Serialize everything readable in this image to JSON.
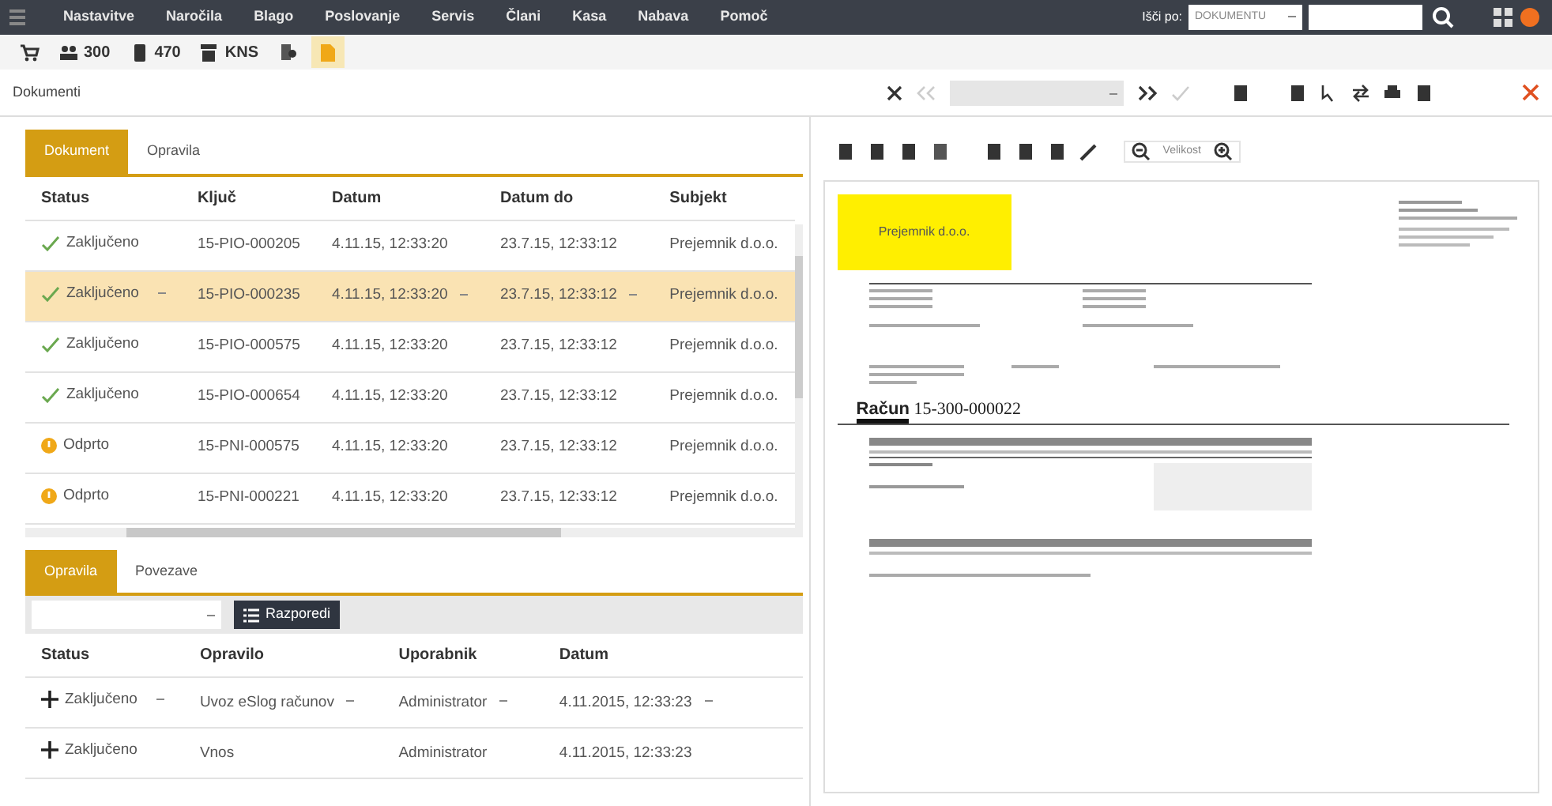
{
  "menu": [
    "Nastavitve",
    "Naročila",
    "Blago",
    "Poslovanje",
    "Servis",
    "Člani",
    "Kasa",
    "Nabava",
    "Pomoč"
  ],
  "search": {
    "label": "Išči po:",
    "option": "DOKUMENTU"
  },
  "toolbar": [
    {
      "kind": "cart",
      "selected": false
    },
    {
      "kind": "people",
      "label": "300",
      "selected": false
    },
    {
      "kind": "phone",
      "label": "470",
      "selected": false
    },
    {
      "kind": "register",
      "label": "KNS",
      "selected": false
    },
    {
      "kind": "contacts",
      "selected": false
    },
    {
      "kind": "file",
      "selected": true
    }
  ],
  "section_title": "Dokumenti",
  "doc_tabs": [
    {
      "label": "Dokument",
      "selected": true
    },
    {
      "label": "Opravila",
      "selected": false
    }
  ],
  "doc_table": {
    "columns": [
      "Status",
      "Ključ",
      "Datum",
      "Datum do",
      "Subjekt"
    ],
    "rows": [
      {
        "kind": "closed",
        "status": "Zaključeno",
        "key": "15-PIO-000205",
        "date": "4.11.15, 12:33:20",
        "date_to": "23.7.15, 12:33:12",
        "subject": "Prejemnik d.o.o.",
        "selected": false
      },
      {
        "kind": "closed",
        "status": "Zaključeno",
        "key": "15-PIO-000235",
        "date": "4.11.15, 12:33:20",
        "date_to": "23.7.15, 12:33:12",
        "subject": "Prejemnik d.o.o.",
        "selected": true
      },
      {
        "kind": "closed",
        "status": "Zaključeno",
        "key": "15-PIO-000575",
        "date": "4.11.15, 12:33:20",
        "date_to": "23.7.15, 12:33:12",
        "subject": "Prejemnik d.o.o.",
        "selected": false
      },
      {
        "kind": "closed",
        "status": "Zaključeno",
        "key": "15-PIO-000654",
        "date": "4.11.15, 12:33:20",
        "date_to": "23.7.15, 12:33:12",
        "subject": "Prejemnik d.o.o.",
        "selected": false
      },
      {
        "kind": "open",
        "status": "Odprto",
        "key": "15-PNI-000575",
        "date": "4.11.15, 12:33:20",
        "date_to": "23.7.15, 12:33:12",
        "subject": "Prejemnik d.o.o.",
        "selected": false
      },
      {
        "kind": "open",
        "status": "Odprto",
        "key": "15-PNI-000221",
        "date": "4.11.15, 12:33:20",
        "date_to": "23.7.15, 12:33:12",
        "subject": "Prejemnik d.o.o.",
        "selected": false
      }
    ]
  },
  "task_tabs": [
    {
      "label": "Opravila",
      "selected": true
    },
    {
      "label": "Povezave",
      "selected": false
    }
  ],
  "arrange_button": "Razporedi",
  "task_table": {
    "columns": [
      "Status",
      "Opravilo",
      "Uporabnik",
      "Datum"
    ],
    "rows": [
      {
        "status": "Zaključeno",
        "task": "Uvoz eSlog računov",
        "user": "Administrator",
        "date": "4.11.2015, 12:33:23",
        "editing": true
      },
      {
        "status": "Zaključeno",
        "task": "Vnos",
        "user": "Administrator",
        "date": "4.11.2015, 12:33:23",
        "editing": false
      }
    ]
  },
  "preview": {
    "zoom": "Velikost",
    "stamp": "Prejemnik d.o.o.",
    "invoice_label": "Račun",
    "invoice_number": "15-300-000022"
  }
}
